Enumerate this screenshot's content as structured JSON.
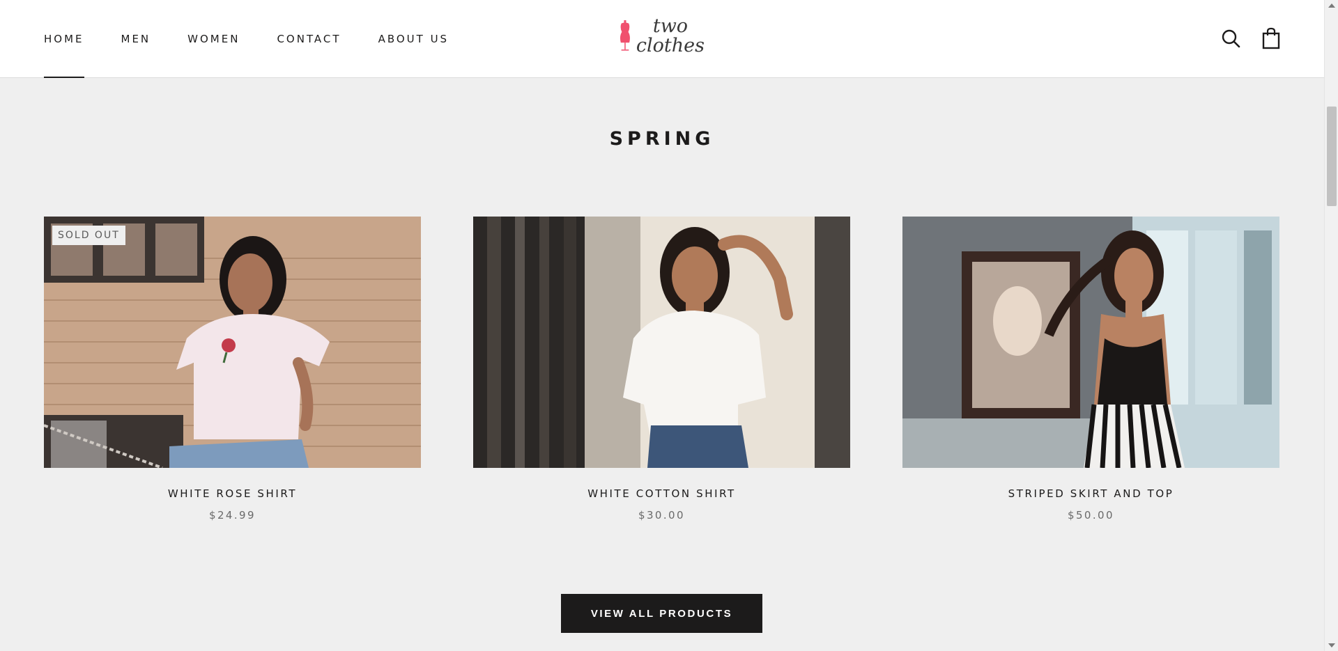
{
  "header": {
    "nav": [
      {
        "label": "HOME",
        "active": true
      },
      {
        "label": "MEN"
      },
      {
        "label": "WOMEN"
      },
      {
        "label": "CONTACT"
      },
      {
        "label": "ABOUT US"
      }
    ],
    "logo": {
      "line1": "two",
      "line2": "clothes",
      "accent": "#f0506e"
    },
    "icons": [
      "search-icon",
      "shopping-bag-icon"
    ]
  },
  "section": {
    "title": "SPRING"
  },
  "products": [
    {
      "name": "WHITE ROSE SHIRT",
      "price": "$24.99",
      "badge": "SOLD OUT"
    },
    {
      "name": "WHITE COTTON SHIRT",
      "price": "$30.00"
    },
    {
      "name": "STRIPED SKIRT AND TOP",
      "price": "$50.00"
    }
  ],
  "cta": {
    "label": "VIEW ALL PRODUCTS"
  },
  "colors": {
    "background": "#efefef",
    "text": "#1c1b1b",
    "button": "#1c1b1b",
    "header": "#ffffff"
  }
}
